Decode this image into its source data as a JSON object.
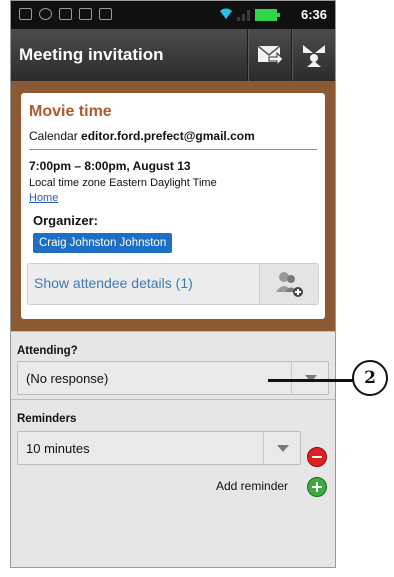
{
  "status_bar": {
    "time": "6:36",
    "battery_color": "#2fd64a"
  },
  "header": {
    "title": "Meeting invitation",
    "actions": [
      "reply-mail-icon",
      "forward-icon"
    ]
  },
  "event": {
    "title": "Movie time",
    "calendar_label": "Calendar",
    "calendar_account": "editor.ford.prefect@gmail.com",
    "time": "7:00pm – 8:00pm, August 13",
    "timezone_label": "Local time zone",
    "timezone_value": "Eastern Daylight Time",
    "location": "Home",
    "organizer_label": "Organizer:",
    "organizer_name": "Craig Johnston Johnston",
    "attendees_label": "Show attendee details (1)"
  },
  "attending": {
    "label": "Attending?",
    "value": "(No response)"
  },
  "reminders": {
    "label": "Reminders",
    "value": "10 minutes",
    "add_label": "Add reminder"
  },
  "callout": {
    "number": "2"
  },
  "colors": {
    "event_title": "#b05a2a",
    "card_border": "#8b5a35",
    "organizer_chip": "#1c6fc4",
    "attendee_link": "#3d7bb3"
  }
}
